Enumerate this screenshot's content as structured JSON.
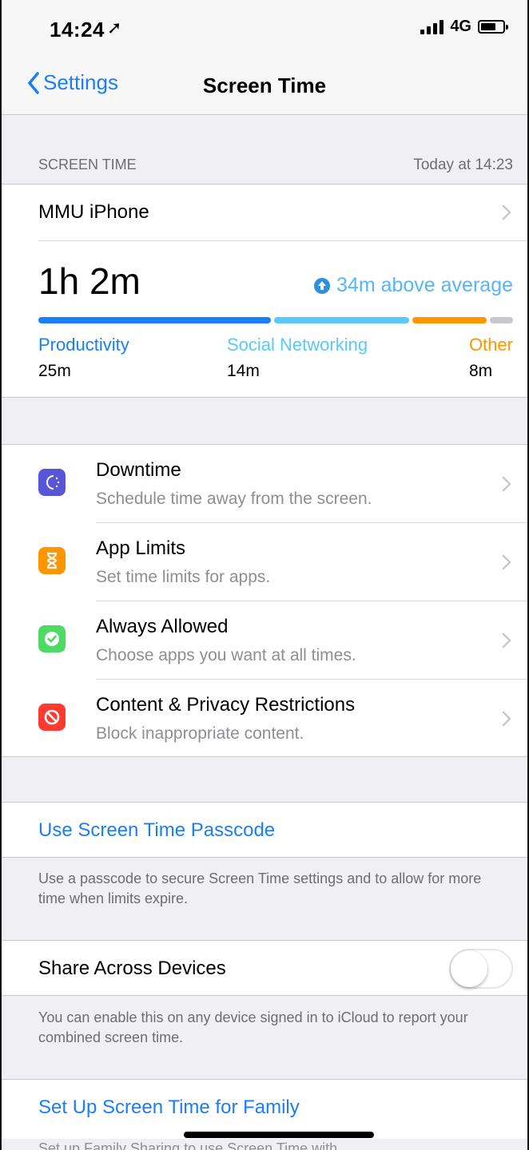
{
  "status_bar": {
    "time": "14:24",
    "location_arrow": "➚",
    "network": "4G"
  },
  "nav": {
    "back_label": "Settings",
    "title": "Screen Time"
  },
  "screen_time": {
    "section_label": "SCREEN TIME",
    "updated": "Today at 14:23",
    "device": "MMU iPhone",
    "total": "1h 2m",
    "average_note": "34m above average",
    "categories": [
      {
        "name": "Productivity",
        "time": "25m",
        "color": "#1a7ff5"
      },
      {
        "name": "Social Networking",
        "time": "14m",
        "color": "#5ac8fa"
      },
      {
        "name": "Other",
        "time": "8m",
        "color": "#ff9500"
      }
    ],
    "bar_shares": [
      {
        "color": "#1a7ff5",
        "share": 0.5
      },
      {
        "color": "#5ac8fa",
        "share": 0.29
      },
      {
        "color": "#ff9500",
        "share": 0.16
      },
      {
        "color": "#c7c7cc",
        "share": 0.05
      }
    ]
  },
  "features": [
    {
      "title": "Downtime",
      "subtitle": "Schedule time away from the screen.",
      "icon": "downtime-icon",
      "color": "#5856d6"
    },
    {
      "title": "App Limits",
      "subtitle": "Set time limits for apps.",
      "icon": "hourglass-icon",
      "color": "#ff9500"
    },
    {
      "title": "Always Allowed",
      "subtitle": "Choose apps you want at all times.",
      "icon": "checkmark-badge-icon",
      "color": "#4cd964"
    },
    {
      "title": "Content & Privacy Restrictions",
      "subtitle": "Block inappropriate content.",
      "icon": "restriction-icon",
      "color": "#ff3b30"
    }
  ],
  "passcode": {
    "label": "Use Screen Time Passcode",
    "footnote": "Use a passcode to secure Screen Time settings and to allow for more time when limits expire."
  },
  "share": {
    "label": "Share Across Devices",
    "enabled": false,
    "footnote": "You can enable this on any device signed in to iCloud to report your combined screen time."
  },
  "family": {
    "label": "Set Up Screen Time for Family",
    "footnote_partial": "Set up Family Sharing to use Screen Time with"
  }
}
